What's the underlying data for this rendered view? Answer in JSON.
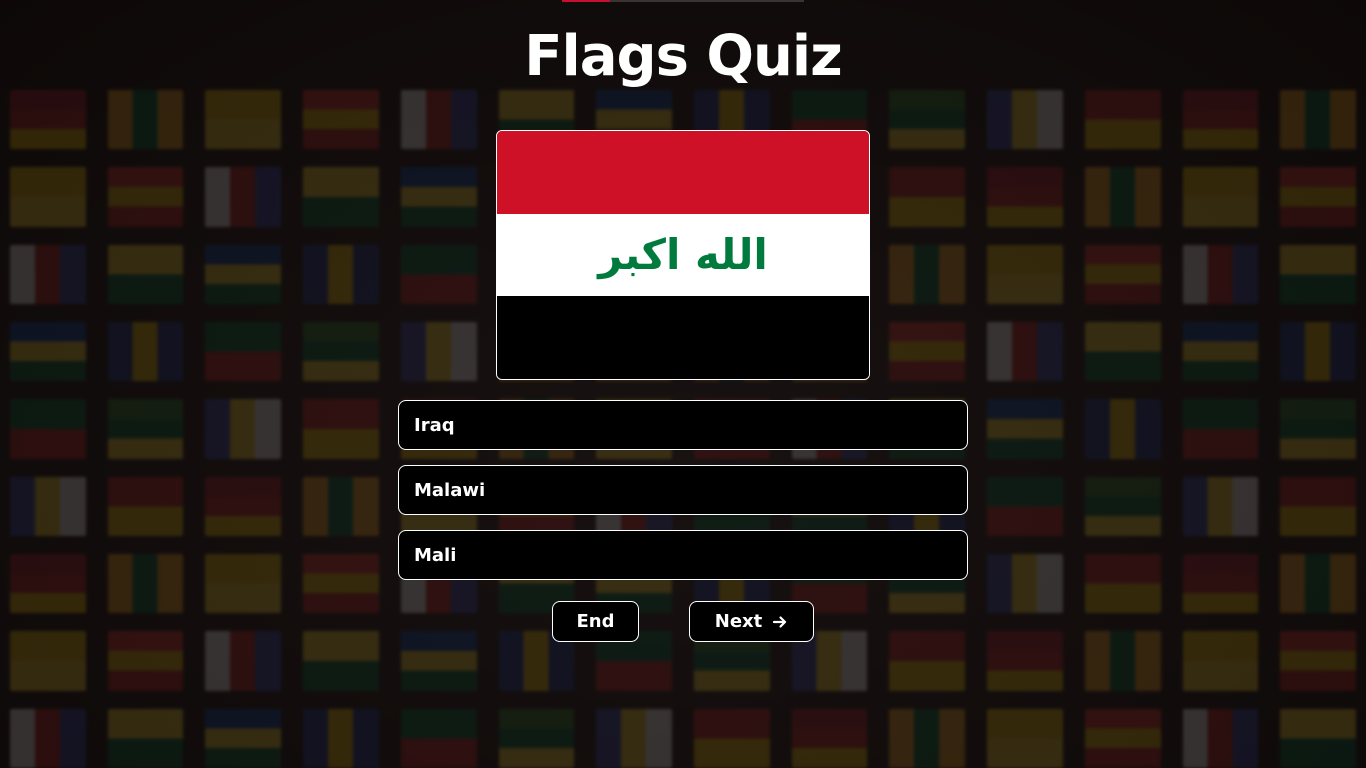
{
  "page": {
    "title": "Flags Quiz"
  },
  "quiz": {
    "progress_fraction": 0.2,
    "flag": {
      "country_colors": [
        "#ce1126",
        "#ffffff",
        "#000000"
      ],
      "emblem_text": "الله اكبر",
      "emblem_color": "#007a3d"
    },
    "options": [
      {
        "label": "Iraq"
      },
      {
        "label": "Malawi"
      },
      {
        "label": "Mali"
      }
    ]
  },
  "controls": {
    "end_label": "End",
    "next_label": "Next",
    "next_icon": "arrow-right-icon"
  },
  "colors": {
    "accent": "#c8102e",
    "button_bg": "#000000",
    "button_border": "#ffffff",
    "text": "#ffffff"
  }
}
